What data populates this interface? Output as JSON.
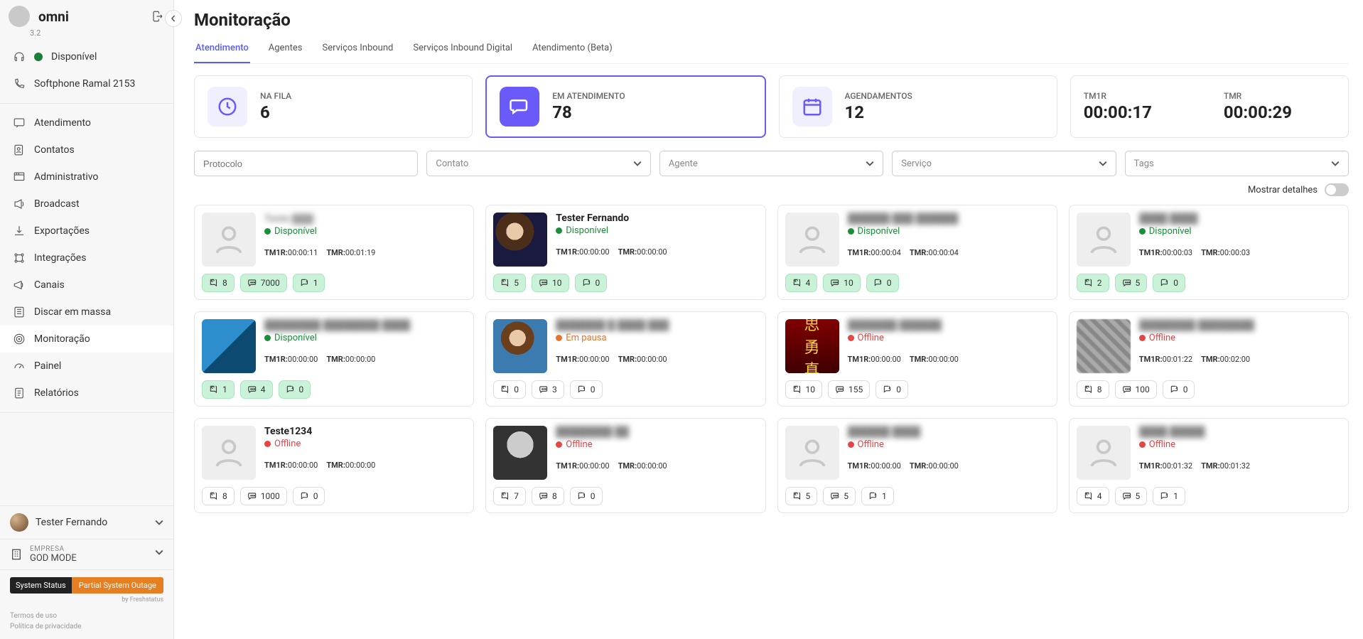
{
  "app": {
    "name": "omni",
    "version": "3.2"
  },
  "sidebar": {
    "availability": "Disponível",
    "softphone": "Softphone Ramal 2153",
    "nav": [
      {
        "label": "Atendimento",
        "icon": "chat-icon"
      },
      {
        "label": "Contatos",
        "icon": "contacts-icon"
      },
      {
        "label": "Administrativo",
        "icon": "admin-icon"
      },
      {
        "label": "Broadcast",
        "icon": "broadcast-icon"
      },
      {
        "label": "Exportações",
        "icon": "download-icon"
      },
      {
        "label": "Integrações",
        "icon": "integrations-icon"
      },
      {
        "label": "Canais",
        "icon": "megaphone-icon"
      },
      {
        "label": "Discar em massa",
        "icon": "dial-icon"
      },
      {
        "label": "Monitoração",
        "icon": "target-icon",
        "active": true
      },
      {
        "label": "Painel",
        "icon": "gauge-icon"
      },
      {
        "label": "Relatórios",
        "icon": "report-icon"
      }
    ],
    "user": "Tester Fernando",
    "company_label": "EMPRESA",
    "company_name": "GOD MODE",
    "system_status_label": "System Status",
    "system_status_msg": "Partial System Outage",
    "freshstatus": "by  Freshstatus",
    "links": [
      "Termos de uso",
      "Política de privacidade"
    ]
  },
  "page": {
    "title": "Monitoração",
    "tabs": [
      "Atendimento",
      "Agentes",
      "Serviços Inbound",
      "Serviços Inbound Digital",
      "Atendimento (Beta)"
    ],
    "active_tab": 0,
    "stats": {
      "queue": {
        "label": "NA FILA",
        "value": "6"
      },
      "serving": {
        "label": "EM ATENDIMENTO",
        "value": "78"
      },
      "sched": {
        "label": "AGENDAMENTOS",
        "value": "12"
      },
      "tm1r": {
        "label": "TM1R",
        "value": "00:00:17"
      },
      "tmr": {
        "label": "TMR",
        "value": "00:00:29"
      }
    },
    "filters": {
      "protocolo": "Protocolo",
      "contato": "Contato",
      "agente": "Agente",
      "servico": "Serviço",
      "tags": "Tags"
    },
    "details_label": "Mostrar detalhes"
  },
  "labels": {
    "tm1r": "TM1R:",
    "tmr": "TMR:"
  },
  "agents": [
    {
      "name": "Teste ▓▓▓",
      "status": "Disponível",
      "status_class": "st-disp",
      "tm1r": "00:00:11",
      "tmr": "00:01:19",
      "m": [
        "8",
        "7000",
        "1"
      ],
      "green": true,
      "avatar": "generic",
      "pix": true
    },
    {
      "name": "Tester Fernando",
      "status": "Disponível",
      "status_class": "st-disp",
      "tm1r": "00:00:00",
      "tmr": "00:00:00",
      "m": [
        "5",
        "10",
        "0"
      ],
      "green": true,
      "avatar": "img1"
    },
    {
      "name": "██████ ███ ██████",
      "status": "Disponível",
      "status_class": "st-disp",
      "tm1r": "00:00:04",
      "tmr": "00:00:04",
      "m": [
        "4",
        "10",
        "0"
      ],
      "green": true,
      "avatar": "generic",
      "pix": true
    },
    {
      "name": "████ ████",
      "status": "Disponível",
      "status_class": "st-disp",
      "tm1r": "00:00:03",
      "tmr": "00:00:03",
      "m": [
        "2",
        "5",
        "0"
      ],
      "green": true,
      "avatar": "generic",
      "pix": true
    },
    {
      "name": "████████ ████████ ████",
      "status": "Disponível",
      "status_class": "st-disp",
      "tm1r": "00:00:00",
      "tmr": "00:00:00",
      "m": [
        "1",
        "4",
        "0"
      ],
      "green": true,
      "avatar": "img2",
      "pix": true
    },
    {
      "name": "███████ █ ████ ███",
      "status": "Em pausa",
      "status_class": "st-pause",
      "tm1r": "00:00:00",
      "tmr": "00:00:00",
      "m": [
        "0",
        "3",
        "0"
      ],
      "green": false,
      "avatar": "img3",
      "pix": true
    },
    {
      "name": "███████ ██████",
      "status": "Offline",
      "status_class": "st-off",
      "tm1r": "00:00:00",
      "tmr": "00:00:00",
      "m": [
        "10",
        "155",
        "0"
      ],
      "green": false,
      "avatar": "img4",
      "pix": true
    },
    {
      "name": "████████ ████████",
      "status": "Offline",
      "status_class": "st-off",
      "tm1r": "00:01:22",
      "tmr": "00:02:00",
      "m": [
        "8",
        "100",
        "0"
      ],
      "green": false,
      "avatar": "img5",
      "pix": true
    },
    {
      "name": "Teste1234",
      "status": "Offline",
      "status_class": "st-off",
      "tm1r": "00:00:00",
      "tmr": "00:00:00",
      "m": [
        "8",
        "1000",
        "0"
      ],
      "green": false,
      "avatar": "generic"
    },
    {
      "name": "████████ ██",
      "status": "Offline",
      "status_class": "st-off",
      "tm1r": "00:00:00",
      "tmr": "00:00:00",
      "m": [
        "7",
        "8",
        "0"
      ],
      "green": false,
      "avatar": "img6",
      "pix": true
    },
    {
      "name": "██████ ████",
      "status": "Offline",
      "status_class": "st-off",
      "tm1r": "00:00:00",
      "tmr": "00:00:00",
      "m": [
        "5",
        "5",
        "1"
      ],
      "green": false,
      "avatar": "generic",
      "pix": true
    },
    {
      "name": "████ █████",
      "status": "Offline",
      "status_class": "st-off",
      "tm1r": "00:01:32",
      "tmr": "00:01:32",
      "m": [
        "4",
        "5",
        "1"
      ],
      "green": false,
      "avatar": "generic",
      "pix": true
    }
  ]
}
